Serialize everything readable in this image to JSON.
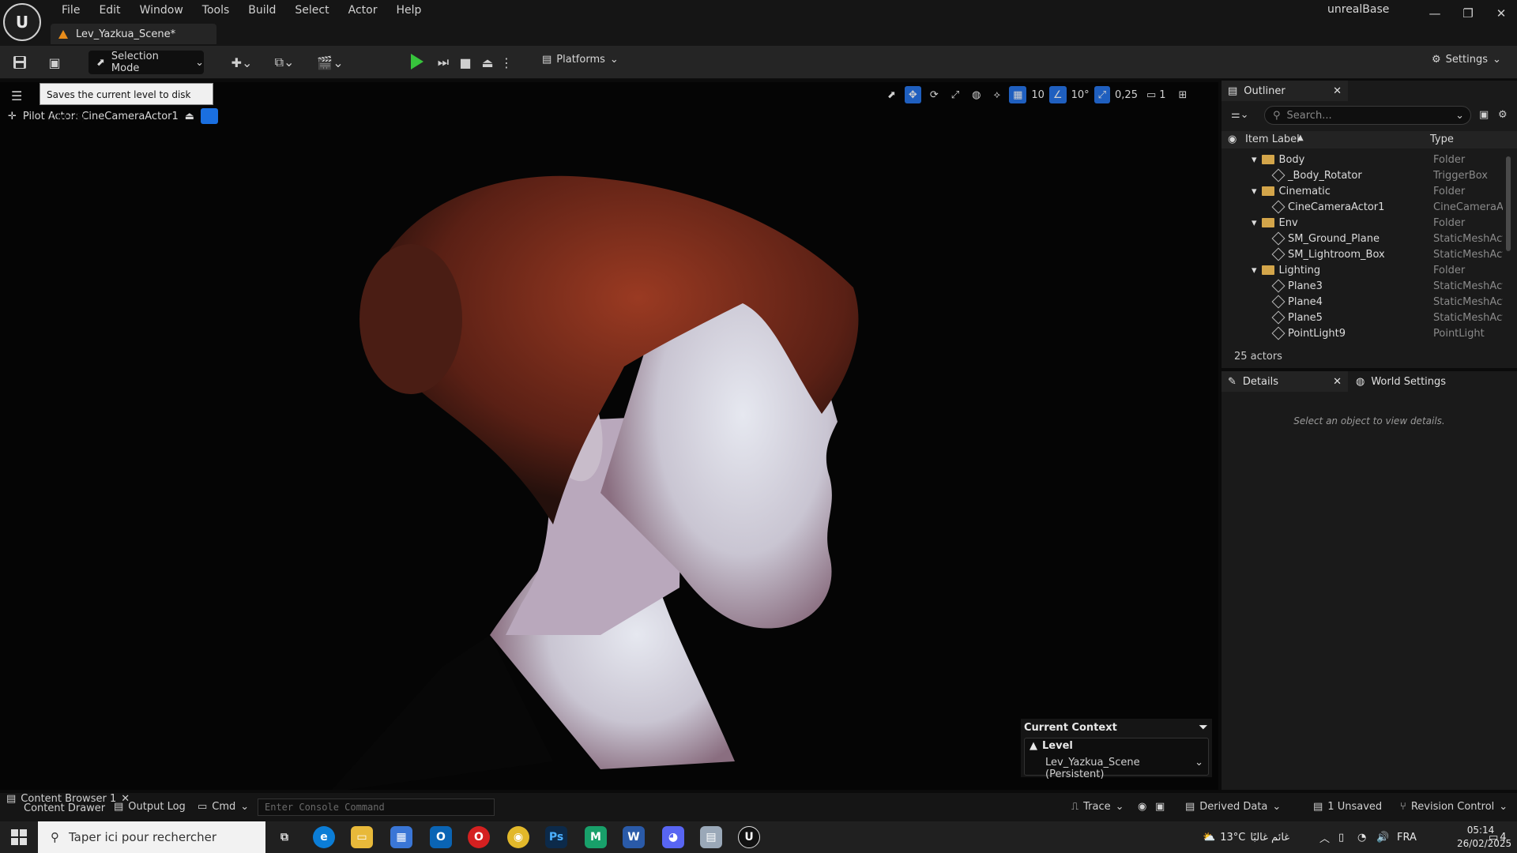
{
  "app": {
    "name": "unrealBase",
    "level_tab": "Lev_Yazkua_Scene*"
  },
  "menu": [
    "File",
    "Edit",
    "Window",
    "Tools",
    "Build",
    "Select",
    "Actor",
    "Help"
  ],
  "toolbar": {
    "selection_mode": "Selection Mode",
    "platforms": "Platforms",
    "settings": "Settings"
  },
  "tooltip": "Saves the current level to disk (Ctrl+S)",
  "viewport": {
    "pilot_actor": "Pilot Actor: CineCameraActor1",
    "grid_snap": "10",
    "rotation_snap": "10°",
    "scale_snap": "0,25",
    "camera_speed": "1"
  },
  "context": {
    "title": "Current Context",
    "level_label": "Level",
    "level_value": "Lev_Yazkua_Scene (Persistent)"
  },
  "outliner": {
    "title": "Outliner",
    "search_placeholder": "Search...",
    "col_label": "Item Label",
    "col_type": "Type",
    "rows": [
      {
        "label": "Body",
        "type": "Folder",
        "kind": "folder"
      },
      {
        "label": "_Body_Rotator",
        "type": "TriggerBox",
        "kind": "item"
      },
      {
        "label": "Cinematic",
        "type": "Folder",
        "kind": "folder"
      },
      {
        "label": "CineCameraActor1",
        "type": "CineCameraAc",
        "kind": "item"
      },
      {
        "label": "Env",
        "type": "Folder",
        "kind": "folder"
      },
      {
        "label": "SM_Ground_Plane",
        "type": "StaticMeshActo",
        "kind": "item"
      },
      {
        "label": "SM_Lightroom_Box",
        "type": "StaticMeshActo",
        "kind": "item"
      },
      {
        "label": "Lighting",
        "type": "Folder",
        "kind": "folder"
      },
      {
        "label": "Plane3",
        "type": "StaticMeshActo",
        "kind": "item"
      },
      {
        "label": "Plane4",
        "type": "StaticMeshActo",
        "kind": "item"
      },
      {
        "label": "Plane5",
        "type": "StaticMeshActo",
        "kind": "item"
      },
      {
        "label": "PointLight9",
        "type": "PointLight",
        "kind": "item"
      }
    ],
    "actor_count": "25 actors"
  },
  "details": {
    "tab": "Details",
    "world_tab": "World Settings",
    "empty_msg": "Select an object to view details."
  },
  "bottombar": {
    "content_browser": "Content Browser 1",
    "content_drawer": "Content Drawer",
    "output_log": "Output Log",
    "cmd": "Cmd",
    "console_placeholder": "Enter Console Command",
    "trace": "Trace",
    "derived_data": "Derived Data",
    "unsaved": "1 Unsaved",
    "revision_control": "Revision Control"
  },
  "taskbar": {
    "search_text": "Taper ici pour rechercher",
    "weather": "13°C",
    "weather_desc": "غائم غالبًا",
    "lang": "FRA",
    "time": "05:14",
    "date": "26/02/2025",
    "notifications": "4"
  }
}
